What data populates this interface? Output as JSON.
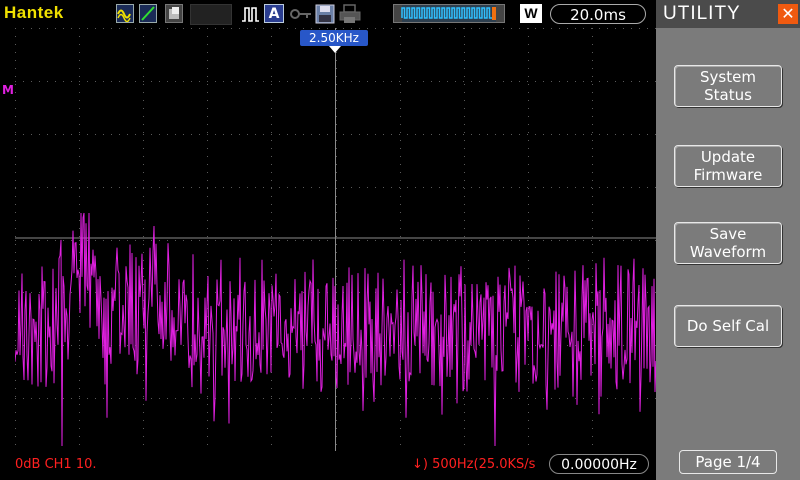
{
  "topbar": {
    "brand": "Hantek",
    "timebase": "20.0ms",
    "window_mode": "W"
  },
  "screen": {
    "trigger_position": "2.50KHz",
    "channel_marker": "M"
  },
  "status": {
    "left": "0dB  CH1  10.",
    "right": "↓)  500Hz(25.0KS/s",
    "frequency": "0.00000Hz"
  },
  "panel": {
    "title": "UTILITY",
    "buttons": [
      "System\nStatus",
      "Update\nFirmware",
      "Save\nWaveform",
      "Do Self Cal"
    ],
    "page": "Page 1/4"
  },
  "colors": {
    "trace": "#e020e0",
    "grid": "#5a5a5a",
    "panel_bg": "#7b7b7b",
    "brand": "#f0e000"
  }
}
